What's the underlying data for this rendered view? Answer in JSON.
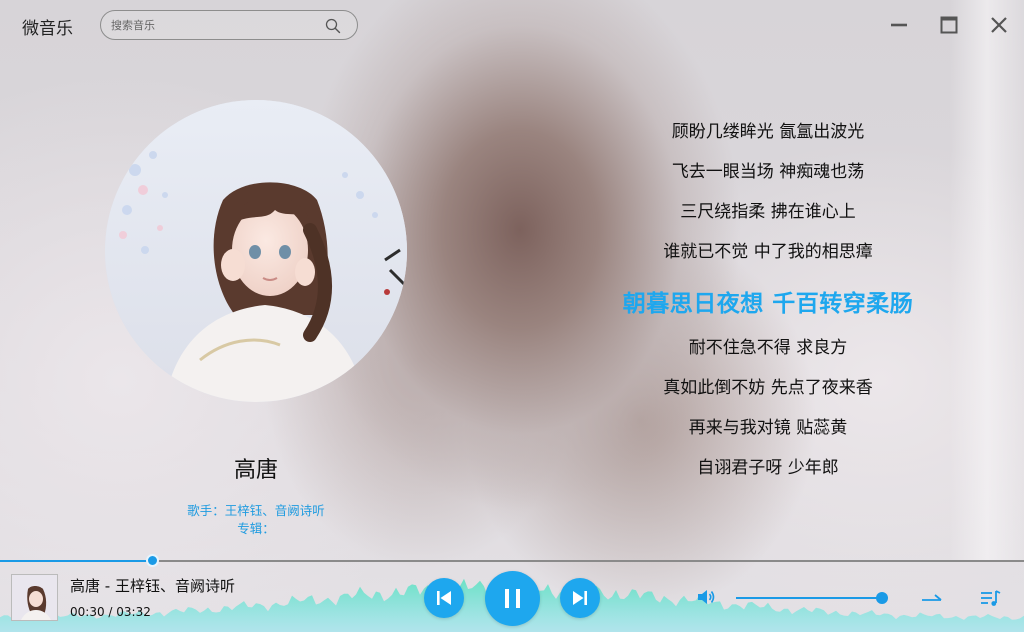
{
  "app": {
    "title": "微音乐"
  },
  "search": {
    "placeholder": "搜索音乐",
    "icon": "search-icon"
  },
  "window_controls": {
    "minimize": "minimize-icon",
    "maximize": "maximize-icon",
    "close": "close-icon"
  },
  "song": {
    "title": "高唐",
    "artist_line": "歌手：王梓钰、音阙诗听",
    "album_line": "专辑："
  },
  "lyrics": {
    "lines": [
      "顾盼几缕眸光 氤氲出波光",
      "飞去一眼当场 神痴魂也荡",
      "三尺绕指柔 拂在谁心上",
      "谁就已不觉 中了我的相思瘴",
      "朝暮思日夜想 千百转穿柔肠",
      "耐不住急不得 求良方",
      "真如此倒不妨 先点了夜来香",
      "再来与我对镜 贴蕊黄",
      "自诩君子呀 少年郎"
    ],
    "active_index": 4
  },
  "player": {
    "now_playing": "高唐 - 王梓钰、音阙诗听",
    "time": "00:30 / 03:32",
    "progress_fraction": 0.148,
    "volume_fraction": 1.0,
    "controls": {
      "prev": "skip-previous-icon",
      "play_pause": "pause-icon",
      "next": "skip-next-icon"
    },
    "volume_icon": "volume-icon",
    "mode_icon": "sequential-mode-icon",
    "playlist_icon": "playlist-icon"
  },
  "colors": {
    "accent": "#1ea7ee",
    "text": "#111111"
  }
}
